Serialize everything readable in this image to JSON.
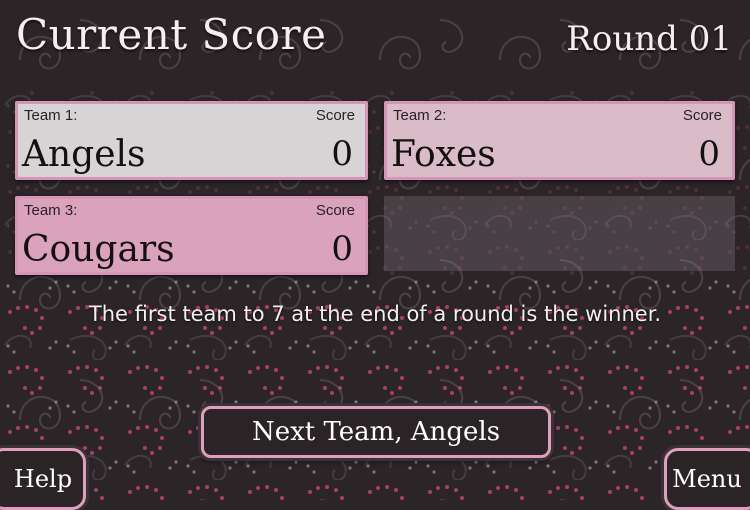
{
  "header": {
    "title": "Current Score",
    "round": "Round 01"
  },
  "teams": [
    {
      "label": "Team 1:",
      "score_label": "Score",
      "name": "Angels",
      "score": "0"
    },
    {
      "label": "Team 2:",
      "score_label": "Score",
      "name": "Foxes",
      "score": "0"
    },
    {
      "label": "Team 3:",
      "score_label": "Score",
      "name": "Cougars",
      "score": "0"
    }
  ],
  "rule": "The first team to 7 at the end of a round is the winner.",
  "buttons": {
    "next": "Next Team, Angels",
    "help": "Help",
    "menu": "Menu"
  },
  "colors": {
    "background": "#2b2527",
    "accent_pink": "#e09ebd",
    "team1_card": "#d8d4d5",
    "team2_card": "#d9bcc8",
    "team3_card": "#dba2bc"
  }
}
